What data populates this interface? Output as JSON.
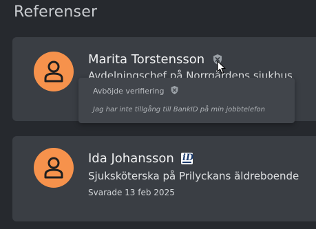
{
  "page": {
    "title": "Referenser"
  },
  "references": [
    {
      "name": "Marita Torstensson",
      "role": "Avdelningschef på Norrgårdens sjukhus",
      "verification_icon": "unverified-shield-x-icon"
    },
    {
      "name": "Ida Johansson",
      "role": "Sjuksköterska på Prilyckans äldreboende",
      "answered": "Svarade 13 feb 2025",
      "verification_icon": "bankid-icon"
    }
  ],
  "tooltip": {
    "title": "Avböjde verifiering",
    "message": "Jag har inte tillgång till BankID på min jobbtelefon"
  },
  "colors": {
    "background": "#26292e",
    "card": "#3a3e44",
    "avatar": "#f6924c",
    "tooltip": "#41454b"
  }
}
